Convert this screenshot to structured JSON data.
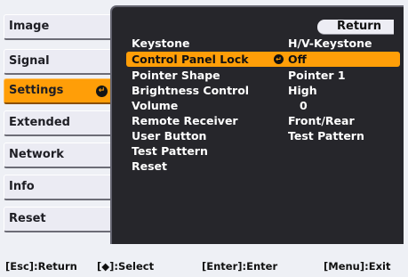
{
  "tabs": [
    {
      "label": "Image",
      "selected": false
    },
    {
      "label": "Signal",
      "selected": false
    },
    {
      "label": "Settings",
      "selected": true
    },
    {
      "label": "Extended",
      "selected": false
    },
    {
      "label": "Network",
      "selected": false
    },
    {
      "label": "Info",
      "selected": false
    },
    {
      "label": "Reset",
      "selected": false
    }
  ],
  "panel": {
    "return_label": "Return",
    "items": [
      {
        "label": "Keystone",
        "value": "H/V-Keystone"
      },
      {
        "label": "Control Panel Lock",
        "value": "Off",
        "selected": true
      },
      {
        "label": "Pointer Shape",
        "value": "Pointer 1"
      },
      {
        "label": "Brightness Control",
        "value": "High"
      },
      {
        "label": "Volume",
        "value": "0"
      },
      {
        "label": "Remote Receiver",
        "value": "Front/Rear"
      },
      {
        "label": "User Button",
        "value": "Test Pattern"
      },
      {
        "label": "Test Pattern",
        "value": ""
      },
      {
        "label": "Reset",
        "value": ""
      }
    ]
  },
  "status": {
    "esc": "[Esc]:Return",
    "select": "[◆]:Select",
    "enter": "[Enter]:Enter",
    "menu": "[Menu]:Exit"
  },
  "icons": {
    "enter": "enter-icon"
  },
  "colors": {
    "accent": "#ff9e08",
    "panel_bg": "#26262b",
    "tab_bg": "#ebebf3",
    "page_bg": "#eef0f5"
  }
}
